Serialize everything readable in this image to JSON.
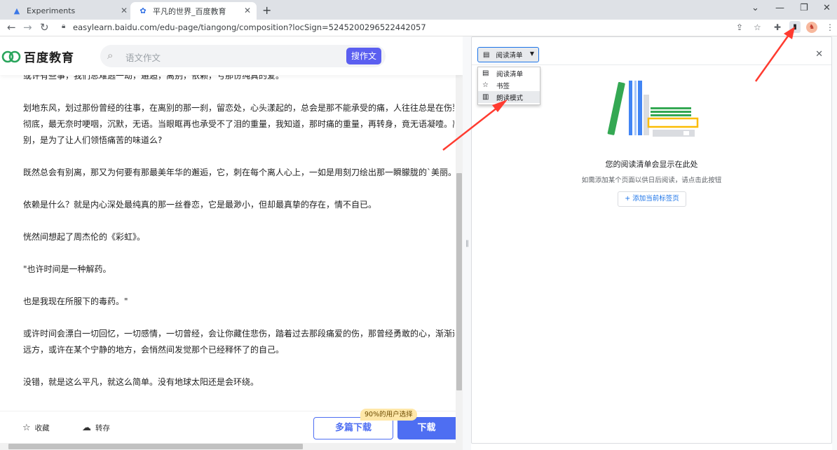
{
  "tabs": [
    {
      "title": "Experiments",
      "favicon": "flask-icon",
      "active": false
    },
    {
      "title": "平凡的世界_百度教育",
      "favicon": "baidu-paw-icon",
      "active": true
    }
  ],
  "toolbar": {
    "url": "easylearn.baidu.com/edu-page/tiangong/composition?locSign=5245200296522442057"
  },
  "site": {
    "logo_text": "百度教育",
    "search_placeholder": "语文作文",
    "search_button": "搜作文"
  },
  "article": {
    "paragraphs": [
      [
        "或许有些事，我们总难逃一劫，邂逅，离别，依赖，亏那份纯真的爱。"
      ],
      [
        "划地东风，划过那份曾经的往事，在离别的那一刹，留恋处，心头漾起的，总会是那不能承受的痛，人往往总是在伤到",
        "彻底，最无奈时哽咽，沉默，无语。当眼眶再也承受不了泪的重量，我知道，那时痛的重量，再转身，竟无语凝噎。离",
        "别，是为了让人们领悟痛苦的味道么?"
      ],
      [
        "既然总会有别离，那又为何要有那最美年华的邂逅，它，刺在每个离人心上，一如是用刻刀绘出那一瞬朦胧的`美丽。"
      ],
      [
        "依赖是什么？就是内心深处最纯真的那一丝眷恋，它是最渺小，但却最真挚的存在，情不自已。"
      ],
      [
        "恍然间想起了周杰伦的《彩虹》。"
      ],
      [
        "\"也许时间是一种解药。"
      ],
      [
        "也是我现在所服下的毒药。\""
      ],
      [
        "或许时间会漂白一切回忆，一切感情，一切曾经，会让你藏住悲伤，踏着过去那段痛爱的伤，那曾经勇敢的心，渐渐远",
        "远方，或许在某个宁静的地方，会悄然间发觉那个已经释怀了的自己。"
      ],
      [
        "没错，就是这么平凡，就这么简单。没有地球太阳还是会环绕。"
      ]
    ]
  },
  "bottom_bar": {
    "favorite": "收藏",
    "save": "转存",
    "multi_download": "多篇下载",
    "download": "下载",
    "badge": "90%的用户选择"
  },
  "side_panel": {
    "selected": "阅读清单",
    "options": [
      "阅读清单",
      "书签",
      "朗读模式"
    ],
    "empty_title": "您的阅读清单会显示在此处",
    "empty_subtitle": "如需添加某个页面以供日后阅读，请点击此按钮",
    "add_button": "+ 添加当前标签页"
  },
  "colors": {
    "accent_blue": "#4e6ef2",
    "search_button": "#5b5ff0",
    "panel_focus": "#1a73e8",
    "annotation_arrow": "#ff3b30"
  }
}
